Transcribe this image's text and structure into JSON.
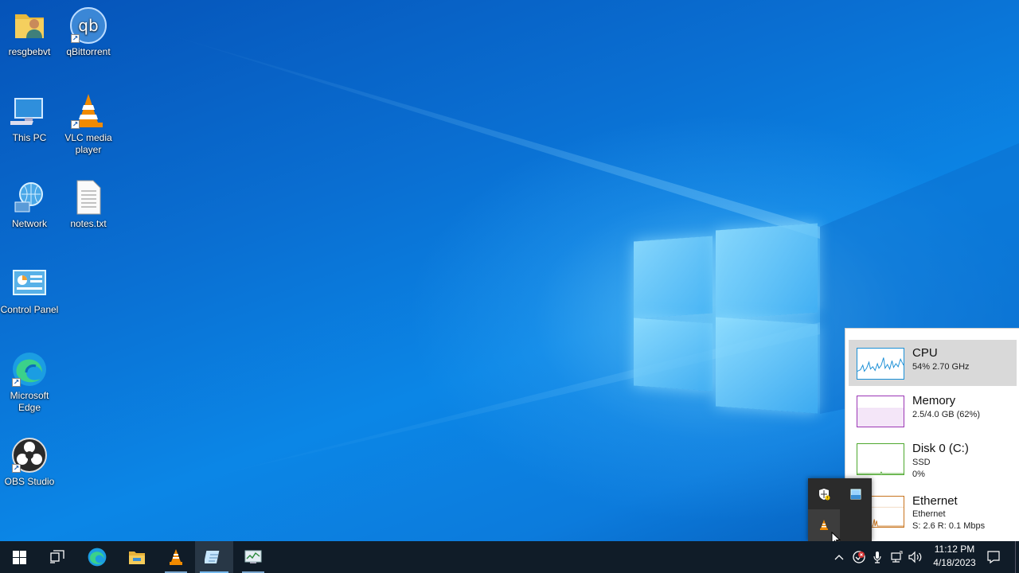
{
  "desktop": {
    "icons": [
      {
        "label": "resgbebvt",
        "icon": "user-folder-icon"
      },
      {
        "label": "qBittorrent",
        "icon": "qbittorrent-icon"
      },
      {
        "label": "This PC",
        "icon": "this-pc-icon"
      },
      {
        "label": "VLC media player",
        "icon": "vlc-icon"
      },
      {
        "label": "Network",
        "icon": "network-icon"
      },
      {
        "label": "notes.txt",
        "icon": "text-file-icon"
      },
      {
        "label": "Control Panel",
        "icon": "control-panel-icon"
      },
      {
        "label": "Microsoft Edge",
        "icon": "edge-icon"
      },
      {
        "label": "OBS Studio",
        "icon": "obs-icon"
      }
    ]
  },
  "perf_flyout": {
    "items": [
      {
        "name": "CPU",
        "line1": "54%  2.70 GHz",
        "color": "#1a8fd6"
      },
      {
        "name": "Memory",
        "line1": "2.5/4.0 GB (62%)",
        "color": "#9b36b5"
      },
      {
        "name": "Disk 0 (C:)",
        "line1": "SSD",
        "line2": "0%",
        "color": "#4da82e"
      },
      {
        "name": "Ethernet",
        "line1": "Ethernet",
        "line2": "S: 2.6  R: 0.1 Mbps",
        "color": "#c8741e"
      }
    ]
  },
  "tray_overflow": {
    "icons": [
      "security-warning-icon",
      "task-manager-icon",
      "vlc-tray-icon"
    ]
  },
  "taskbar": {
    "apps": [
      "start-icon",
      "task-view-icon",
      "edge-icon",
      "file-explorer-icon",
      "vlc-icon",
      "notepad-icon",
      "task-manager-icon"
    ],
    "clock": {
      "time": "11:12 PM",
      "date": "4/18/2023"
    }
  }
}
